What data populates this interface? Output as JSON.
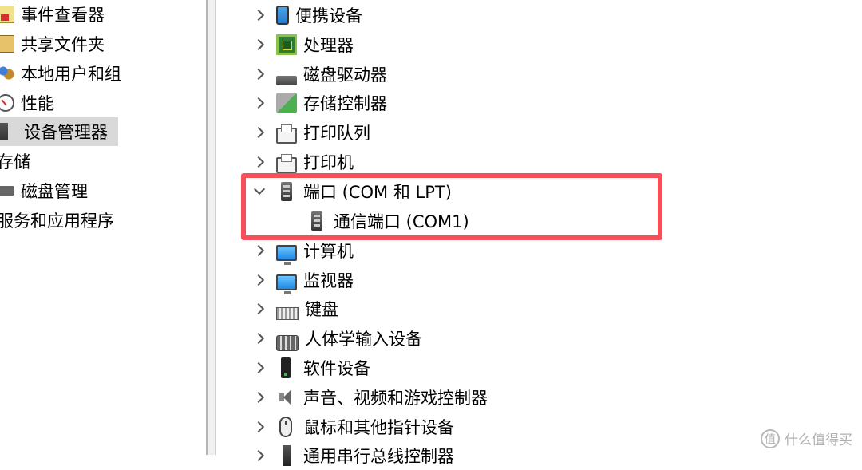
{
  "nav": {
    "items": [
      {
        "label": "事件查看器",
        "icon": "event-viewer-icon"
      },
      {
        "label": "共享文件夹",
        "icon": "shared-folders-icon"
      },
      {
        "label": "本地用户和组",
        "icon": "local-users-icon"
      },
      {
        "label": "性能",
        "icon": "performance-icon"
      },
      {
        "label": "设备管理器",
        "icon": "device-manager-icon",
        "selected": true
      },
      {
        "label": "存储",
        "icon": null
      },
      {
        "label": "磁盘管理",
        "icon": "disk-management-icon"
      },
      {
        "label": "服务和应用程序",
        "icon": null
      }
    ]
  },
  "tree": {
    "items": [
      {
        "label": "便携设备",
        "icon": "portable-device-icon",
        "expanded": false
      },
      {
        "label": "处理器",
        "icon": "processor-icon",
        "expanded": false
      },
      {
        "label": "磁盘驱动器",
        "icon": "disk-drive-icon",
        "expanded": false
      },
      {
        "label": "存储控制器",
        "icon": "storage-controller-icon",
        "expanded": false
      },
      {
        "label": "打印队列",
        "icon": "printer-icon",
        "expanded": false
      },
      {
        "label": "打印机",
        "icon": "printer-icon",
        "expanded": false
      },
      {
        "label": "端口 (COM 和 LPT)",
        "icon": "port-icon",
        "expanded": true
      },
      {
        "label": "通信端口 (COM1)",
        "icon": "port-icon",
        "child": true
      },
      {
        "label": "计算机",
        "icon": "computer-icon",
        "expanded": false
      },
      {
        "label": "监视器",
        "icon": "monitor-icon",
        "expanded": false
      },
      {
        "label": "键盘",
        "icon": "keyboard-icon",
        "expanded": false
      },
      {
        "label": "人体学输入设备",
        "icon": "hid-icon",
        "expanded": false
      },
      {
        "label": "软件设备",
        "icon": "software-device-icon",
        "expanded": false
      },
      {
        "label": "声音、视频和游戏控制器",
        "icon": "speaker-icon",
        "expanded": false
      },
      {
        "label": "鼠标和其他指针设备",
        "icon": "mouse-icon",
        "expanded": false
      },
      {
        "label": "通用串行总线控制器",
        "icon": "usb-icon",
        "expanded": false
      }
    ]
  },
  "highlight_color": "#f5505a",
  "watermark": {
    "logo": "值",
    "text": "什么值得买"
  }
}
